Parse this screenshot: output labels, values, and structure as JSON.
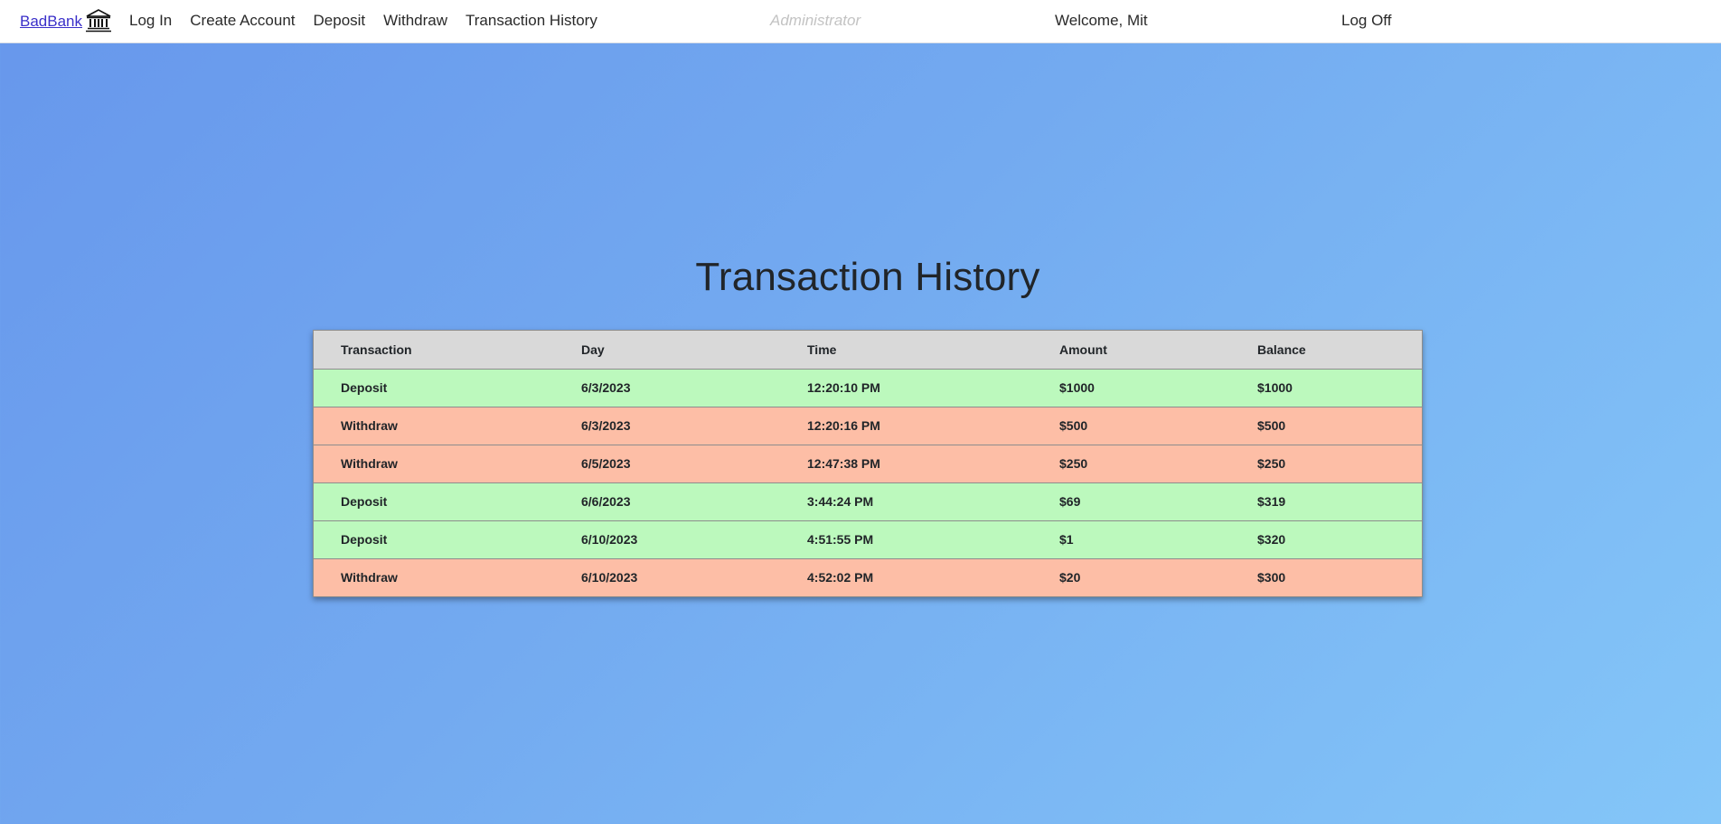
{
  "navbar": {
    "brand": "BadBank",
    "brand_icon": "bank-icon",
    "links": [
      "Log In",
      "Create Account",
      "Deposit",
      "Withdraw",
      "Transaction History"
    ],
    "admin": "Administrator",
    "welcome": "Welcome, Mit",
    "logoff": "Log Off"
  },
  "page": {
    "title": "Transaction History"
  },
  "table": {
    "headers": [
      "Transaction",
      "Day",
      "Time",
      "Amount",
      "Balance"
    ],
    "rows": [
      {
        "type": "Deposit",
        "day": "6/3/2023",
        "time": "12:20:10 PM",
        "amount": "$1000",
        "balance": "$1000"
      },
      {
        "type": "Withdraw",
        "day": "6/3/2023",
        "time": "12:20:16 PM",
        "amount": "$500",
        "balance": "$500"
      },
      {
        "type": "Withdraw",
        "day": "6/5/2023",
        "time": "12:47:38 PM",
        "amount": "$250",
        "balance": "$250"
      },
      {
        "type": "Deposit",
        "day": "6/6/2023",
        "time": "3:44:24 PM",
        "amount": "$69",
        "balance": "$319"
      },
      {
        "type": "Deposit",
        "day": "6/10/2023",
        "time": "4:51:55 PM",
        "amount": "$1",
        "balance": "$320"
      },
      {
        "type": "Withdraw",
        "day": "6/10/2023",
        "time": "4:52:02 PM",
        "amount": "$20",
        "balance": "$300"
      }
    ]
  },
  "colors": {
    "deposit_row": "#bcf9bd",
    "withdraw_row": "#fdbea6",
    "header_row": "#d9d9d9",
    "brand_link": "#3a2fc9"
  }
}
